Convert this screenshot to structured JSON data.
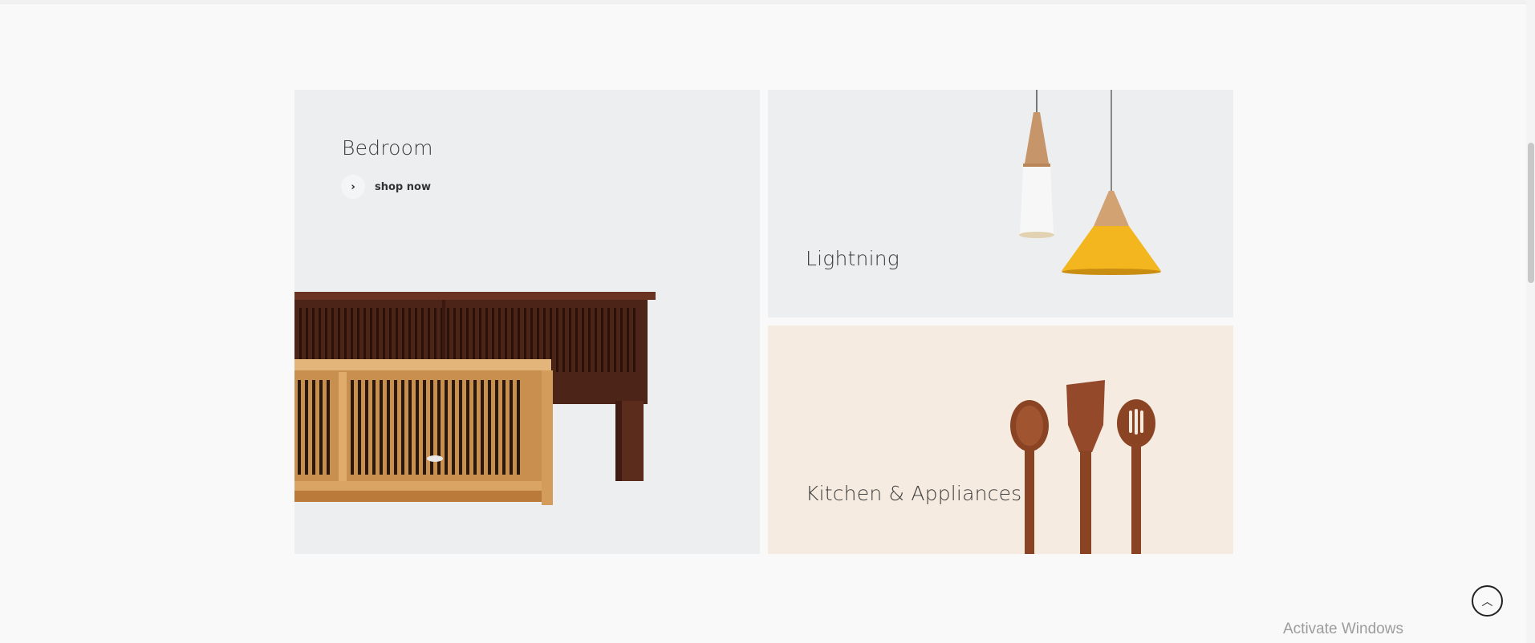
{
  "banners": {
    "bedroom": {
      "title": "Bedroom",
      "link_label": "shop now",
      "link_icon": "chevron-right-icon"
    },
    "lighting": {
      "title": "Lightning"
    },
    "kitchen": {
      "title": "Kitchen & Appliances"
    }
  },
  "scroll_top": {
    "icon": "chevron-up-icon",
    "glyph": "︿"
  },
  "watermark": {
    "text": "Activate Windows"
  },
  "colors": {
    "page_bg": "#f9f9f9",
    "banner_gray": "#eceef0",
    "banner_cream": "#f6ebe0",
    "lamp_yellow": "#f3b61f",
    "wood_dark": "#5e2e1c",
    "wood_light": "#d8a35e"
  }
}
